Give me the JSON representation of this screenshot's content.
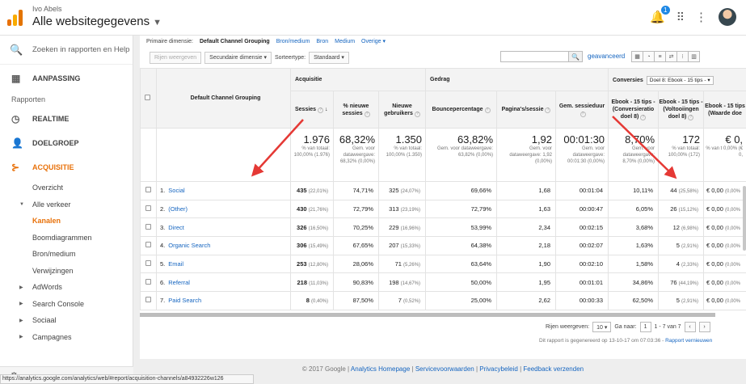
{
  "header": {
    "account": "Ivo Abels",
    "property": "Alle websitegegevens",
    "notification_count": "1"
  },
  "sidebar": {
    "search_placeholder": "Zoeken in rapporten en Help",
    "customization": "AANPASSING",
    "reports_label": "Rapporten",
    "items": [
      {
        "label": "REALTIME",
        "icon": "clock-icon"
      },
      {
        "label": "DOELGROEP",
        "icon": "person-icon"
      },
      {
        "label": "ACQUISITIE",
        "icon": "acquisition-icon"
      }
    ],
    "sub": {
      "overview": "Overzicht",
      "all_traffic": "Alle verkeer",
      "channels": "Kanalen",
      "treemaps": "Boomdiagrammen",
      "source_medium": "Bron/medium",
      "referrals": "Verwijzingen",
      "adwords": "AdWords",
      "search_console": "Search Console",
      "social": "Sociaal",
      "campaigns": "Campagnes"
    }
  },
  "dimensions": {
    "label": "Primaire dimensie:",
    "active": "Default Channel Grouping",
    "others": [
      "Bron/medium",
      "Bron",
      "Medium",
      "Overige ▾"
    ]
  },
  "controls": {
    "plot_rows": "Rijen weergeven",
    "secondary": "Secundaire dimensie ▾",
    "sort_label": "Sorteertype:",
    "sort_value": "Standaard ▾",
    "advanced": "geavanceerd"
  },
  "table": {
    "dimension_header": "Default Channel Grouping",
    "groups": {
      "acquisition": "Acquisitie",
      "behavior": "Gedrag",
      "conversions": "Conversies",
      "goal_select": "Doel 8: Ebook - 15 tips - ▾"
    },
    "columns": [
      "Sessies",
      "% nieuwe sessies",
      "Nieuwe gebruikers",
      "Bouncepercentage",
      "Pagina's/sessie",
      "Gem. sessieduur",
      "Ebook - 15 tips - (Conversieratio doel 8)",
      "Ebook - 15 tips - (Voltooiingen doel 8)",
      "Ebook - 15 tips (Waarde doe"
    ],
    "totals": [
      {
        "big": "1.976",
        "small": "% van totaal: 100,00% (1.976)"
      },
      {
        "big": "68,32%",
        "small": "Gem. voor dataweergave: 68,32% (0,00%)"
      },
      {
        "big": "1.350",
        "small": "% van totaal: 100,00% (1.350)"
      },
      {
        "big": "63,82%",
        "small": "Gem. voor dataweergave: 63,82% (0,00%)"
      },
      {
        "big": "1,92",
        "small": "Gem. voor dataweergave: 1,92 (0,00%)"
      },
      {
        "big": "00:01:30",
        "small": "Gem. voor dataweergave: 00:01:30 (0,00%)"
      },
      {
        "big": "8,70%",
        "small": "Gem. voor dataweergave: 8,70% (0,00%)"
      },
      {
        "big": "172",
        "small": "% van totaal: 100,00% (172)"
      },
      {
        "big": "€ 0,",
        "small": "% van t 0,00% (€ 0,"
      }
    ],
    "rows": [
      {
        "idx": "1.",
        "name": "Social",
        "sessions": "435",
        "sessions_pct": "(22,01%)",
        "new_pct": "74,71%",
        "new_users": "325",
        "new_users_pct": "(24,07%)",
        "bounce": "69,66%",
        "pages": "1,68",
        "duration": "00:01:04",
        "conv_rate": "10,11%",
        "completions": "44",
        "completions_pct": "(25,58%)",
        "value": "€ 0,00",
        "value_pct": "(0,00%"
      },
      {
        "idx": "2.",
        "name": "(Other)",
        "sessions": "430",
        "sessions_pct": "(21,76%)",
        "new_pct": "72,79%",
        "new_users": "313",
        "new_users_pct": "(23,19%)",
        "bounce": "72,79%",
        "pages": "1,63",
        "duration": "00:00:47",
        "conv_rate": "6,05%",
        "completions": "26",
        "completions_pct": "(15,12%)",
        "value": "€ 0,00",
        "value_pct": "(0,00%"
      },
      {
        "idx": "3.",
        "name": "Direct",
        "sessions": "326",
        "sessions_pct": "(16,50%)",
        "new_pct": "70,25%",
        "new_users": "229",
        "new_users_pct": "(16,96%)",
        "bounce": "53,99%",
        "pages": "2,34",
        "duration": "00:02:15",
        "conv_rate": "3,68%",
        "completions": "12",
        "completions_pct": "(6,98%)",
        "value": "€ 0,00",
        "value_pct": "(0,00%"
      },
      {
        "idx": "4.",
        "name": "Organic Search",
        "sessions": "306",
        "sessions_pct": "(15,49%)",
        "new_pct": "67,65%",
        "new_users": "207",
        "new_users_pct": "(15,33%)",
        "bounce": "64,38%",
        "pages": "2,18",
        "duration": "00:02:07",
        "conv_rate": "1,63%",
        "completions": "5",
        "completions_pct": "(2,91%)",
        "value": "€ 0,00",
        "value_pct": "(0,00%"
      },
      {
        "idx": "5.",
        "name": "Email",
        "sessions": "253",
        "sessions_pct": "(12,80%)",
        "new_pct": "28,06%",
        "new_users": "71",
        "new_users_pct": "(5,26%)",
        "bounce": "63,64%",
        "pages": "1,90",
        "duration": "00:02:10",
        "conv_rate": "1,58%",
        "completions": "4",
        "completions_pct": "(2,33%)",
        "value": "€ 0,00",
        "value_pct": "(0,00%"
      },
      {
        "idx": "6.",
        "name": "Referral",
        "sessions": "218",
        "sessions_pct": "(11,03%)",
        "new_pct": "90,83%",
        "new_users": "198",
        "new_users_pct": "(14,67%)",
        "bounce": "50,00%",
        "pages": "1,95",
        "duration": "00:01:01",
        "conv_rate": "34,86%",
        "completions": "76",
        "completions_pct": "(44,19%)",
        "value": "€ 0,00",
        "value_pct": "(0,00%"
      },
      {
        "idx": "7.",
        "name": "Paid Search",
        "sessions": "8",
        "sessions_pct": "(0,40%)",
        "new_pct": "87,50%",
        "new_users": "7",
        "new_users_pct": "(0,52%)",
        "bounce": "25,00%",
        "pages": "2,62",
        "duration": "00:00:33",
        "conv_rate": "62,50%",
        "completions": "5",
        "completions_pct": "(2,91%)",
        "value": "€ 0,00",
        "value_pct": "(0,00%"
      }
    ]
  },
  "pager": {
    "rows_label": "Rijen weergeven:",
    "rows_value": "10 ▾",
    "goto_label": "Ga naar:",
    "goto_value": "1",
    "range": "1 - 7 van 7",
    "generated": "Dit rapport is gegenereerd op 13-10-17 om 07:03:36 -",
    "refresh": "Rapport vernieuwen"
  },
  "footer": {
    "copyright": "© 2017 Google |",
    "links": [
      "Analytics Homepage",
      "Servicevoorwaarden",
      "Privacybeleid",
      "Feedback verzenden"
    ]
  },
  "statusbar": "https://analytics.google.com/analytics/web/#report/acquisition-channels/a84932226w126",
  "colors": {
    "accent": "#e8710a",
    "link": "#1565c0",
    "arrow": "#e53935"
  }
}
